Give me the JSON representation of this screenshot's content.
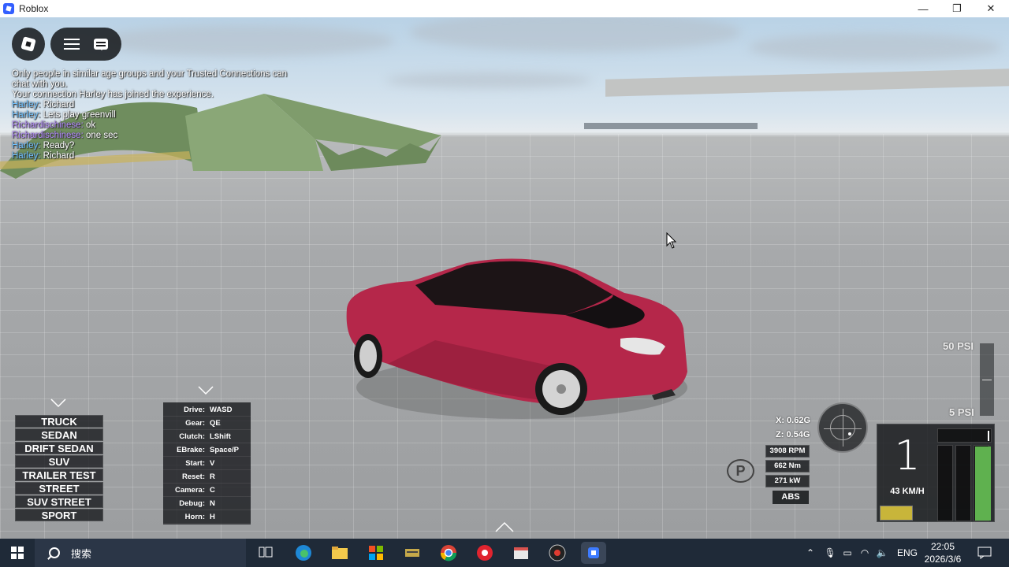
{
  "window": {
    "title": "Roblox",
    "minimize": "—",
    "restore": "❐",
    "close": "✕"
  },
  "chat": {
    "system_1": "Only people in similar age groups and your Trusted Connections can",
    "system_2": "chat with you.",
    "system_3": "Your connection Harley has joined the experience.",
    "messages": [
      {
        "name": "Harley:",
        "text": " Richard"
      },
      {
        "name": "Harley:",
        "text": " Lets play greenvill"
      },
      {
        "name": "Richardischinese:",
        "text": " ok"
      },
      {
        "name": "Richardischinese:",
        "text": " one sec"
      },
      {
        "name": "Harley:",
        "text": " Ready?"
      },
      {
        "name": "Harley:",
        "text": " Richard"
      }
    ]
  },
  "vehicles": {
    "items": [
      "TRUCK",
      "SEDAN",
      "DRIFT SEDAN",
      "SUV",
      "TRAILER TEST",
      "STREET",
      "SUV STREET",
      "SPORT"
    ]
  },
  "controls": {
    "rows": [
      {
        "key": "Drive:",
        "value": "WASD"
      },
      {
        "key": "Gear:",
        "value": "QE"
      },
      {
        "key": "Clutch:",
        "value": "LShift"
      },
      {
        "key": "EBrake:",
        "value": "Space/P"
      },
      {
        "key": "Start:",
        "value": "V"
      },
      {
        "key": "Reset:",
        "value": "R"
      },
      {
        "key": "Camera:",
        "value": "C"
      },
      {
        "key": "Debug:",
        "value": "N"
      },
      {
        "key": "Horn:",
        "value": "H"
      }
    ]
  },
  "hud": {
    "psi_max": "50 PSI",
    "psi_min": "5 PSI",
    "g_x": "X: 0.62G",
    "g_z": "Z: 0.54G",
    "rpm": "3908 RPM",
    "torque": "662 Nm",
    "power": "271 kW",
    "abs": "ABS",
    "park": "P",
    "gear": "1",
    "speed": "43 KM/H"
  },
  "taskbar": {
    "search_text": "搜索",
    "tray_lang": "ENG",
    "time": "22:05",
    "date": "2026/3/6"
  },
  "colors": {
    "car": "#b5274a",
    "throttle": "#5fb14f",
    "fuel": "#c8b53a",
    "taskbar": "#1f2a38"
  }
}
